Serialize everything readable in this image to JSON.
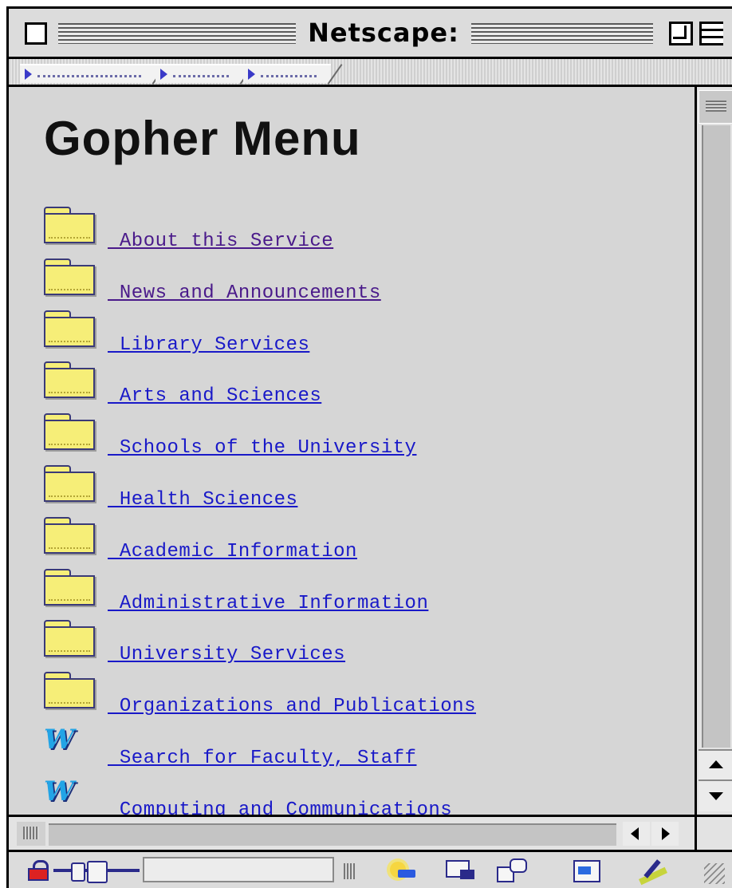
{
  "window": {
    "title": "Netscape:"
  },
  "page": {
    "heading": "Gopher Menu",
    "items": [
      {
        "label": " About this Service",
        "icon": "folder-icon",
        "visited": true
      },
      {
        "label": " News and Announcements",
        "icon": "folder-icon",
        "visited": true
      },
      {
        "label": " Library Services",
        "icon": "folder-icon",
        "visited": false
      },
      {
        "label": " Arts and Sciences",
        "icon": "folder-icon",
        "visited": false
      },
      {
        "label": " Schools of the University",
        "icon": "folder-icon",
        "visited": false
      },
      {
        "label": " Health Sciences",
        "icon": "folder-icon",
        "visited": false
      },
      {
        "label": " Academic Information",
        "icon": "folder-icon",
        "visited": false
      },
      {
        "label": " Administrative Information",
        "icon": "folder-icon",
        "visited": false
      },
      {
        "label": " University Services",
        "icon": "folder-icon",
        "visited": false
      },
      {
        "label": " Organizations and Publications",
        "icon": "folder-icon",
        "visited": false
      },
      {
        "label": " Search for Faculty, Staff",
        "icon": "w-search-icon",
        "visited": false
      },
      {
        "label": " Computing and Communications",
        "icon": "w-search-icon",
        "visited": false
      }
    ]
  },
  "status": {
    "text": ""
  },
  "colors": {
    "link": "#1919c8",
    "visited_link": "#4a1a8a",
    "content_bg": "#d6d6d6",
    "folder": "#f6ee78",
    "w_icon": "#22a4e6"
  }
}
